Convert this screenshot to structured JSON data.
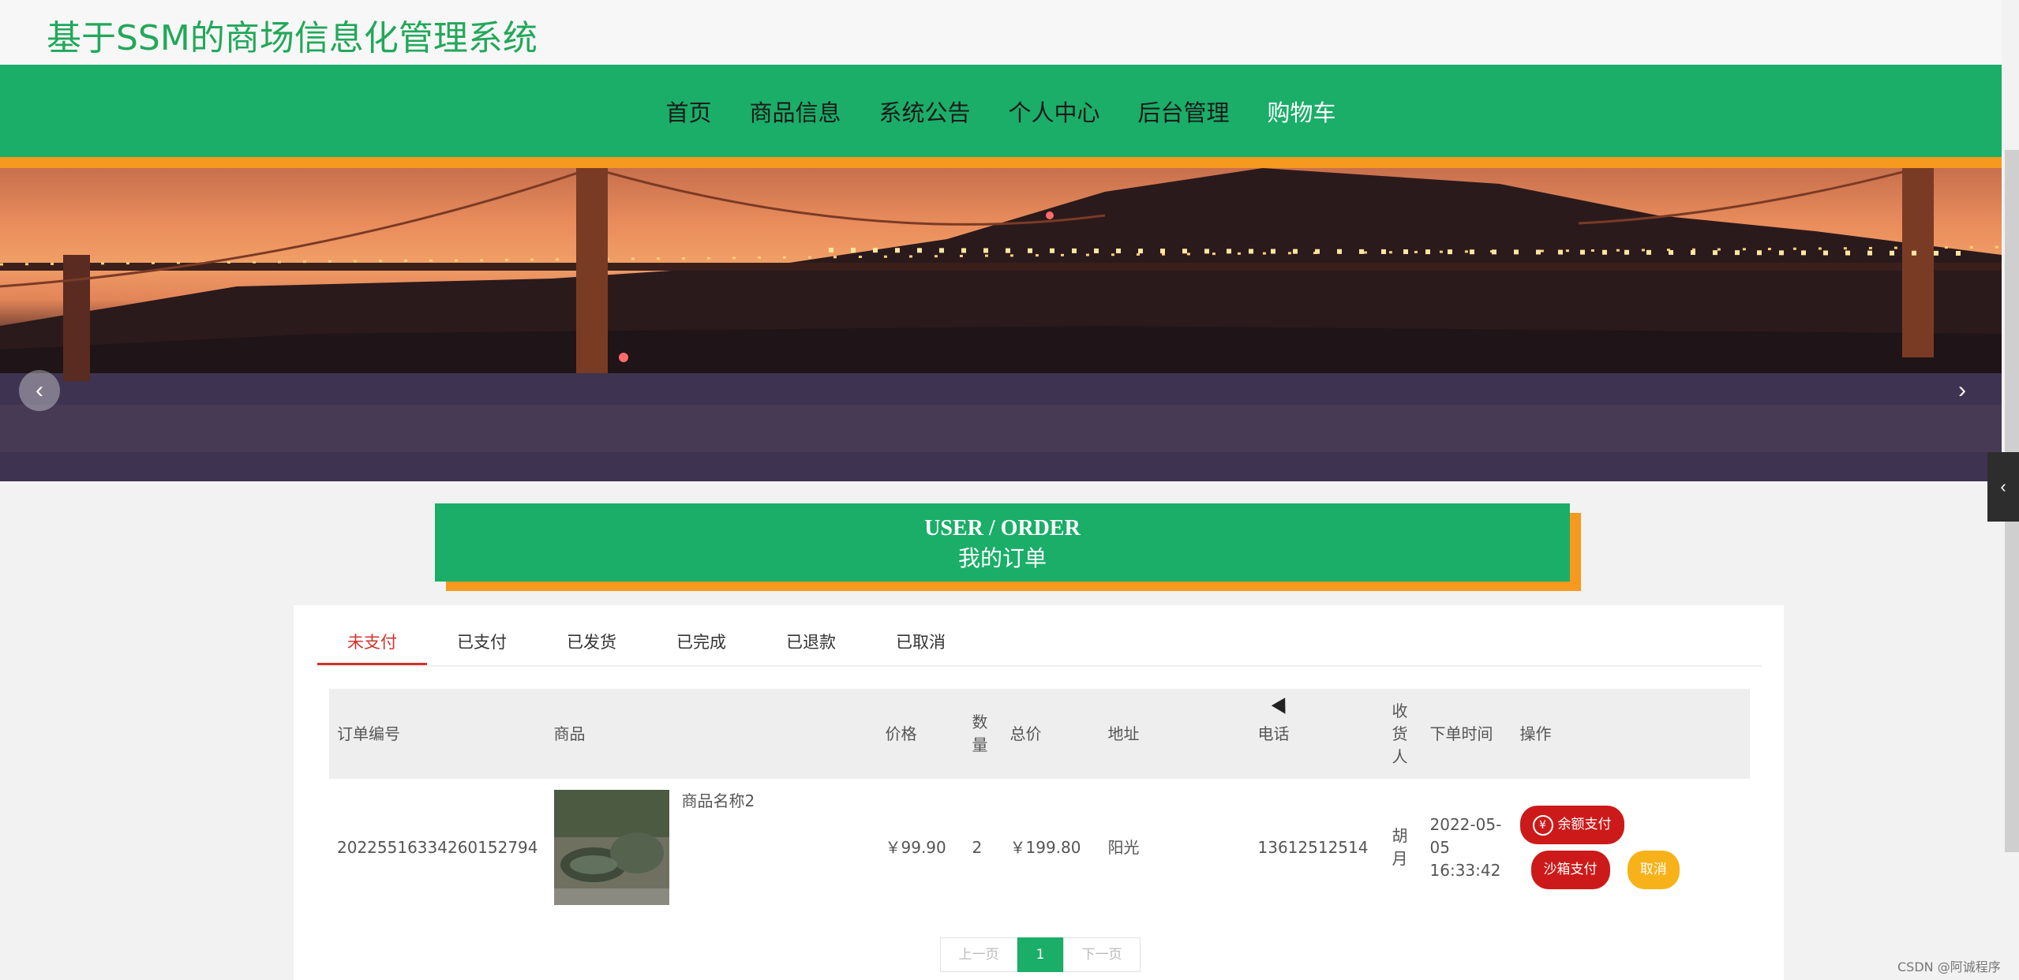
{
  "header": {
    "title": "基于SSM的商场信息化管理系统"
  },
  "nav": {
    "items": [
      {
        "label": "首页"
      },
      {
        "label": "商品信息"
      },
      {
        "label": "系统公告"
      },
      {
        "label": "个人中心"
      },
      {
        "label": "后台管理"
      },
      {
        "label": "购物车"
      }
    ]
  },
  "banner": {
    "prev_icon": "chevron-left-icon",
    "next_icon": "chevron-right-icon",
    "prev": "‹",
    "next": "›"
  },
  "section": {
    "en": "USER / ORDER",
    "cn": "我的订单"
  },
  "tabs": [
    "未支付",
    "已支付",
    "已发货",
    "已完成",
    "已退款",
    "已取消"
  ],
  "table": {
    "headers": {
      "order_no": "订单编号",
      "goods": "商品",
      "price": "价格",
      "qty": "数量",
      "total": "总价",
      "address": "地址",
      "phone": "电话",
      "receiver": "收货人",
      "time": "下单时间",
      "ops": "操作"
    },
    "rows": [
      {
        "order_no": "20225516334260152794",
        "goods_name": "商品名称2",
        "price": "￥99.90",
        "qty": "2",
        "total": "￥199.80",
        "address": "阳光",
        "phone": "13612512514",
        "receiver": "胡月",
        "time": "2022-05-05 16:33:42",
        "btn_balance": "余额支付",
        "btn_sandbox": "沙箱支付",
        "btn_cancel": "取消"
      }
    ]
  },
  "pager": {
    "prev": "上一页",
    "current": "1",
    "next": "下一页"
  },
  "watermark": "CSDN @阿诚程序",
  "side_tab": "‹",
  "colors": {
    "primary_green": "#1aae68",
    "accent_orange": "#f59a1f",
    "danger_red": "#cc1a1a",
    "warning_yellow": "#f7b21a"
  }
}
